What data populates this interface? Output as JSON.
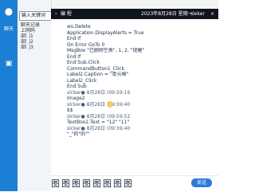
{
  "left_rail": {
    "label": "聊天",
    "icons": [
      "person-icon",
      "car-icon"
    ]
  },
  "left_panel": {
    "search_value": "输入关键词",
    "items": [
      "聊天记录",
      "上网码",
      "部门1",
      "部门2",
      "部门3"
    ]
  },
  "topbar": {
    "back_icon": "arrow-left-icon",
    "mode_text": "编 程",
    "date_text": "2023年8月28日 星期一",
    "user_text": "sleker",
    "close_icon": "close-icon"
  },
  "code_lines": [
    "ws.Delete",
    "Application.DisplayAlerts = True",
    "End If",
    "On Error GoTo 0",
    "MsgBox \"已删除空表\", 1, 2, \"提醒\"",
    "End If",
    "",
    "End Sub.Click",
    "CommandButton1_Click",
    "Label2.Caption = \"单元格\"",
    "Label2_Click",
    "End Sub",
    "slcker● 8月28日 (09:59:19",
    "Image2",
    "slcker● 8月28日 (09:59:40",
    "$$",
    "slcker● 8月28日 (09:59:52",
    "TextBox2.Text = \"12\" \"11\"",
    "slcker● 8月28日 (09:59:40",
    "\"_\"的\"的\"\""
  ],
  "bottom": {
    "input_text": "图图图图图图图图",
    "send_label": "发送"
  }
}
